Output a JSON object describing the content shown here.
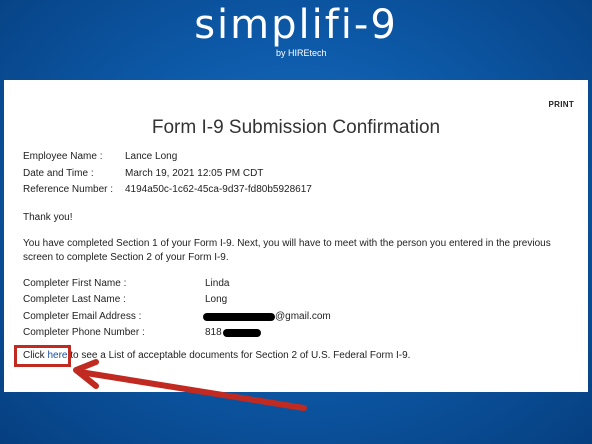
{
  "brand": {
    "logo": "simplifi-9",
    "tagline": "by HIREtech"
  },
  "card": {
    "print": "PRINT",
    "title": "Form I-9 Submission Confirmation",
    "employee_name_label": "Employee Name :",
    "employee_name_value": "Lance Long",
    "date_label": "Date and Time :",
    "date_value": "March 19, 2021 12:05 PM CDT",
    "ref_label": "Reference Number :",
    "ref_value": "4194a50c-1c62-45ca-9d37-fd80b5928617",
    "thanks": "Thank you!",
    "message": "You have completed Section 1 of your Form I-9. Next, you will have to meet with the person you entered in the previous screen to complete Section 2 of your Form I-9.",
    "completer_first_label": "Completer First Name :",
    "completer_first_value": "Linda",
    "completer_last_label": "Completer Last Name :",
    "completer_last_value": "Long",
    "completer_email_label": "Completer Email Address :",
    "completer_email_suffix": "@gmail.com",
    "completer_phone_label": "Completer Phone Number :",
    "completer_phone_prefix": "818",
    "click_text": "Click ",
    "here_link": "here",
    "see_text": " to see a List of acceptable documents for Section 2 of U.S. Federal Form I-9."
  },
  "colors": {
    "background": "#0d5aa9",
    "link": "#1a4fa0",
    "annotation": "#c02a20"
  }
}
